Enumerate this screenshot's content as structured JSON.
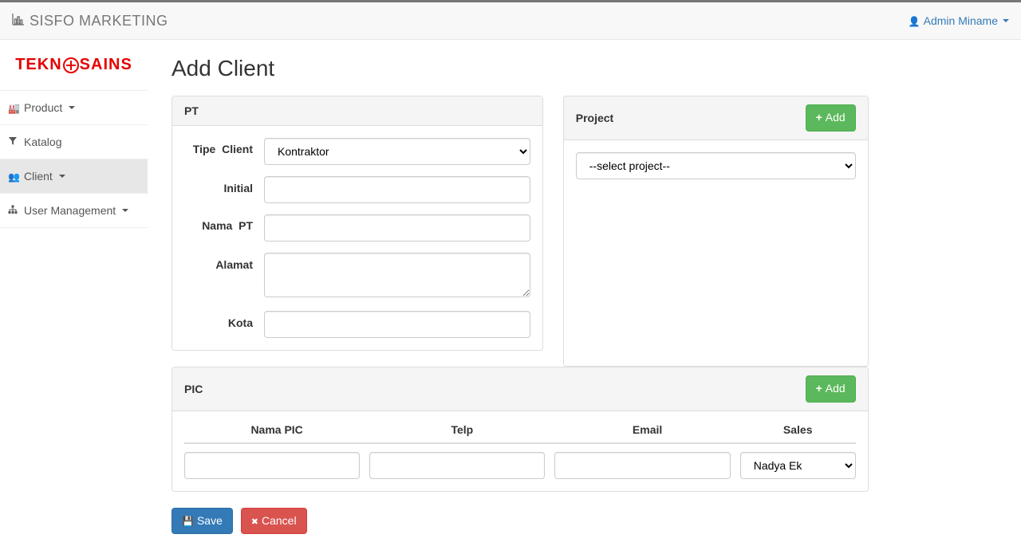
{
  "navbar": {
    "brand": "SISFO MARKETING",
    "user": "Admin Miname"
  },
  "logo": {
    "text_left": "TEKN",
    "text_right": "SAINS"
  },
  "sidebar": {
    "items": [
      {
        "label": "Product",
        "has_caret": true,
        "icon": "dashboard-icon"
      },
      {
        "label": "Katalog",
        "has_caret": false,
        "icon": "filter-icon"
      },
      {
        "label": "Client",
        "has_caret": true,
        "icon": "users-icon",
        "active": true
      },
      {
        "label": "User Management",
        "has_caret": true,
        "icon": "sitemap-icon"
      }
    ]
  },
  "page": {
    "title": "Add Client"
  },
  "panel_pt": {
    "heading": "PT",
    "fields": {
      "tipe_client": {
        "label_line1": "Tipe",
        "label_line2": "Client",
        "value": "Kontraktor"
      },
      "initial": {
        "label": "Initial",
        "value": ""
      },
      "nama_pt": {
        "label_line1": "Nama",
        "label_line2": "PT",
        "value": ""
      },
      "alamat": {
        "label": "Alamat",
        "value": ""
      },
      "kota": {
        "label": "Kota",
        "value": ""
      }
    }
  },
  "panel_project": {
    "heading": "Project",
    "add_label": "Add",
    "select_placeholder": "--select project--"
  },
  "panel_pic": {
    "heading": "PIC",
    "add_label": "Add",
    "columns": [
      "Nama PIC",
      "Telp",
      "Email",
      "Sales"
    ],
    "row": {
      "nama": "",
      "telp": "",
      "email": "",
      "sales_selected": "Nadya Ek"
    }
  },
  "actions": {
    "save": "Save",
    "cancel": "Cancel"
  }
}
